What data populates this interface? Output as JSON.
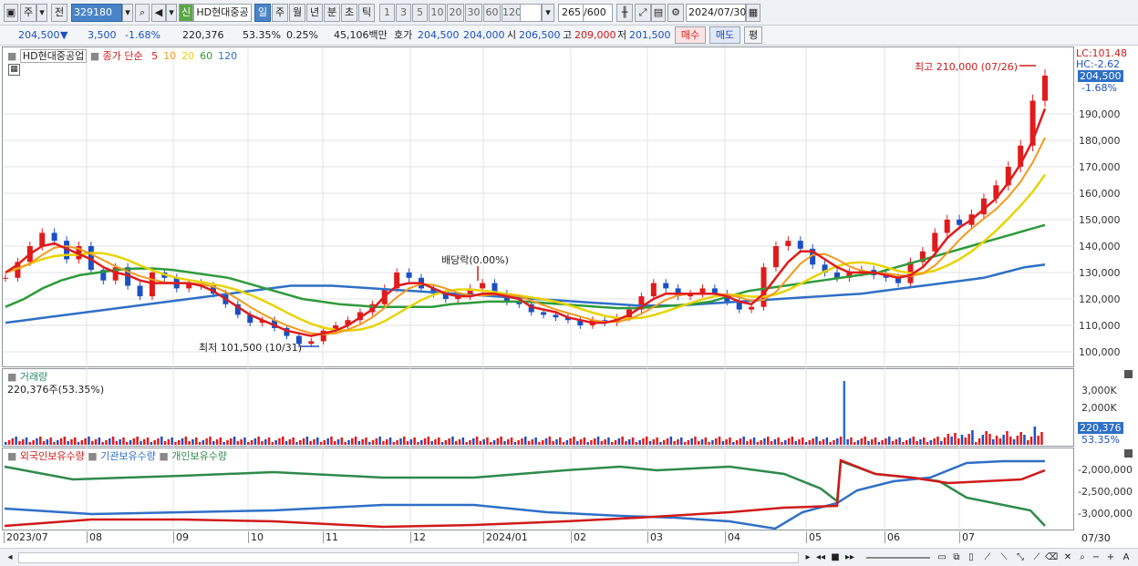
{
  "toolbar": {
    "period_type": "주",
    "prev_label": "전",
    "stock_code": "329180",
    "new_badge": "신",
    "stock_name": "HD현대중공",
    "periods": [
      "일",
      "주",
      "월",
      "년",
      "분",
      "초",
      "틱"
    ],
    "active_period": "일",
    "intervals": [
      "1",
      "3",
      "5",
      "10",
      "20",
      "30",
      "60",
      "120"
    ],
    "count": "265",
    "count_max": "/600",
    "date": "2024/07/30"
  },
  "quote": {
    "price": "204,500",
    "arrow": "▼",
    "change": "3,500",
    "change_pct": "-1.68%",
    "volume": "220,376",
    "vol_ratio": "53.35%",
    "turnover_pct": "0.25%",
    "amount": "45,106백만",
    "bid_label": "호가",
    "bid1": "204,500",
    "bid2": "204,000",
    "open_label": "시",
    "open": "206,500",
    "high_label": "고",
    "high": "209,000",
    "low_label": "저",
    "low": "201,500",
    "buy_label": "매수",
    "sell_label": "매도",
    "eval_label": "평"
  },
  "price_panel": {
    "name": "HD현대중공업",
    "ma_label": "종가 단순",
    "ma_periods": [
      {
        "label": "5",
        "color": "#e01b1b"
      },
      {
        "label": "10",
        "color": "#f39a1c"
      },
      {
        "label": "20",
        "color": "#e8d300"
      },
      {
        "label": "60",
        "color": "#2e9a3a"
      },
      {
        "label": "120",
        "color": "#2f6fc6"
      }
    ],
    "lc": "LC:101.48",
    "hc": "HC:-2.62",
    "last_price": "204,500",
    "last_pct": "-1.68%",
    "high_note": "최고 210,000 (07/26)",
    "low_note": "최저 101,500 (10/31)",
    "dividend_note": "배당락(0.00%)",
    "y_ticks": [
      "190,000",
      "180,000",
      "170,000",
      "160,000",
      "150,000",
      "140,000",
      "130,000",
      "120,000",
      "110,000",
      "100,000"
    ]
  },
  "volume_panel": {
    "title": "거래량",
    "value": "220,376주(53.35%)",
    "y_ticks": [
      "3,000K",
      "2,000K",
      "1,000K"
    ],
    "last_value": "220,376",
    "last_pct": "53.35%"
  },
  "holder_panel": {
    "legends": [
      {
        "label": "외국인보유수량",
        "color": "#d01a1a"
      },
      {
        "label": "기관보유수량",
        "color": "#2f6fc6"
      },
      {
        "label": "개인보유수량",
        "color": "#2e8a4a"
      }
    ],
    "y_ticks": [
      "-2,000,000",
      "-2,500,000",
      "-3,000,000"
    ]
  },
  "x_axis": {
    "labels": [
      "2023/07",
      "08",
      "09",
      "10",
      "11",
      "12",
      "2024/01",
      "02",
      "03",
      "04",
      "05",
      "06",
      "07"
    ],
    "last": "07/30"
  },
  "chart_data": {
    "type": "line",
    "candle_close": [
      128000,
      134000,
      140000,
      145000,
      142000,
      135000,
      140000,
      131000,
      127000,
      132000,
      125000,
      121000,
      130000,
      128000,
      124000,
      126000,
      125000,
      122000,
      118000,
      114000,
      111000,
      112000,
      109000,
      106000,
      103000,
      104000,
      108000,
      110000,
      112000,
      115000,
      118000,
      124000,
      130000,
      128000,
      124000,
      122000,
      120000,
      121000,
      124000,
      126000,
      122000,
      119000,
      118000,
      115000,
      114000,
      113000,
      112000,
      110000,
      112000,
      111000,
      113000,
      116000,
      121000,
      126000,
      124000,
      121000,
      122000,
      124000,
      122000,
      119000,
      116000,
      117000,
      132000,
      140000,
      142000,
      139000,
      133000,
      130000,
      128000,
      130000,
      131000,
      129000,
      128000,
      126000,
      134000,
      138000,
      145000,
      150000,
      148000,
      152000,
      158000,
      163000,
      170000,
      178000,
      195000,
      204500
    ],
    "ma5": [
      130000,
      133000,
      137000,
      140000,
      141000,
      139000,
      137000,
      135000,
      132000,
      130000,
      129000,
      127000,
      126000,
      126000,
      126000,
      126000,
      125000,
      123000,
      120000,
      117000,
      114000,
      112000,
      110000,
      108000,
      107000,
      106000,
      107000,
      108000,
      110000,
      113000,
      116000,
      121000,
      125000,
      126000,
      126000,
      124000,
      122000,
      121000,
      121000,
      122000,
      122000,
      121000,
      120000,
      117000,
      116000,
      115000,
      113000,
      112000,
      111000,
      111000,
      112000,
      114000,
      117000,
      120000,
      122000,
      122000,
      122000,
      122000,
      122000,
      121000,
      119000,
      118000,
      122000,
      128000,
      134000,
      138000,
      138000,
      135000,
      132000,
      130000,
      130000,
      130000,
      129000,
      128000,
      129000,
      132000,
      137000,
      143000,
      147000,
      150000,
      154000,
      158000,
      164000,
      171000,
      180000,
      192000
    ],
    "ma60": [
      117000,
      120000,
      124000,
      127000,
      129000,
      130000,
      131000,
      131500,
      131500,
      131000,
      130000,
      129000,
      128000,
      126000,
      124000,
      122000,
      120000,
      119000,
      118000,
      117500,
      117000,
      117000,
      117000,
      117000,
      118000,
      118500,
      119000,
      119000,
      119000,
      118500,
      118000,
      117500,
      117000,
      116500,
      116500,
      117000,
      117500,
      118000,
      119000,
      121000,
      123000,
      124000,
      125000,
      126000,
      127000,
      128000,
      129000,
      130000,
      132000,
      134000,
      136000,
      138000,
      140000,
      142000,
      144000,
      146000,
      148000
    ],
    "ma120": [
      111000,
      112000,
      113000,
      114000,
      115000,
      116000,
      117000,
      118000,
      119000,
      120000,
      121000,
      122000,
      123000,
      124000,
      125000,
      125000,
      125000,
      124500,
      124000,
      123500,
      123000,
      122500,
      122000,
      121500,
      121000,
      120500,
      120000,
      119500,
      119000,
      118500,
      118000,
      117500,
      117500,
      117500,
      118000,
      118500,
      119000,
      119500,
      120000,
      120500,
      121000,
      121500,
      122000,
      123000,
      124000,
      125000,
      126000,
      127000,
      128000,
      130000,
      132000,
      133000
    ],
    "ylim": [
      95000,
      215000
    ]
  }
}
